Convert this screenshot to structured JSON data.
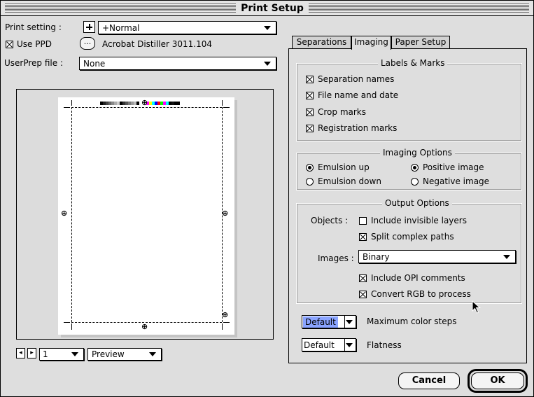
{
  "window": {
    "title": "Print Setup"
  },
  "left": {
    "print_setting_label": "Print setting :",
    "print_setting_value": "+Normal",
    "use_ppd_label": "Use PPD",
    "use_ppd_checked": true,
    "ppd_button_label": "...",
    "ppd_name": "Acrobat Distiller 3011.104",
    "userprep_label": "UserPrep file :",
    "userprep_value": "None",
    "page_number": "1",
    "view_mode": "Preview"
  },
  "tabs": [
    {
      "label": "Separations",
      "active": false
    },
    {
      "label": "Imaging",
      "active": true
    },
    {
      "label": "Paper Setup",
      "active": false
    }
  ],
  "labels_marks": {
    "title": "Labels & Marks",
    "items": [
      {
        "label": "Separation names",
        "checked": true
      },
      {
        "label": "File name and date",
        "checked": true
      },
      {
        "label": "Crop marks",
        "checked": true
      },
      {
        "label": "Registration marks",
        "checked": true
      }
    ]
  },
  "imaging_options": {
    "title": "Imaging Options",
    "emulsion_up": "Emulsion up",
    "emulsion_down": "Emulsion down",
    "positive_image": "Positive image",
    "negative_image": "Negative image",
    "emulsion_selected": "up",
    "image_selected": "positive"
  },
  "output_options": {
    "title": "Output Options",
    "objects_label": "Objects :",
    "include_invisible_layers": {
      "label": "Include invisible layers",
      "checked": false
    },
    "split_complex_paths": {
      "label": "Split complex paths",
      "checked": true
    },
    "images_label": "Images :",
    "images_value": "Binary",
    "include_opi_comments": {
      "label": "Include OPI comments",
      "checked": true
    },
    "convert_rgb": {
      "label": "Convert RGB to process",
      "checked": true
    }
  },
  "max_color_steps": {
    "value": "Default",
    "label": "Maximum color steps"
  },
  "flatness": {
    "value": "Default",
    "label": "Flatness"
  },
  "buttons": {
    "cancel": "Cancel",
    "ok": "OK"
  },
  "colors": {
    "selection": "#8aa4ff",
    "window_bg": "#dedede"
  }
}
